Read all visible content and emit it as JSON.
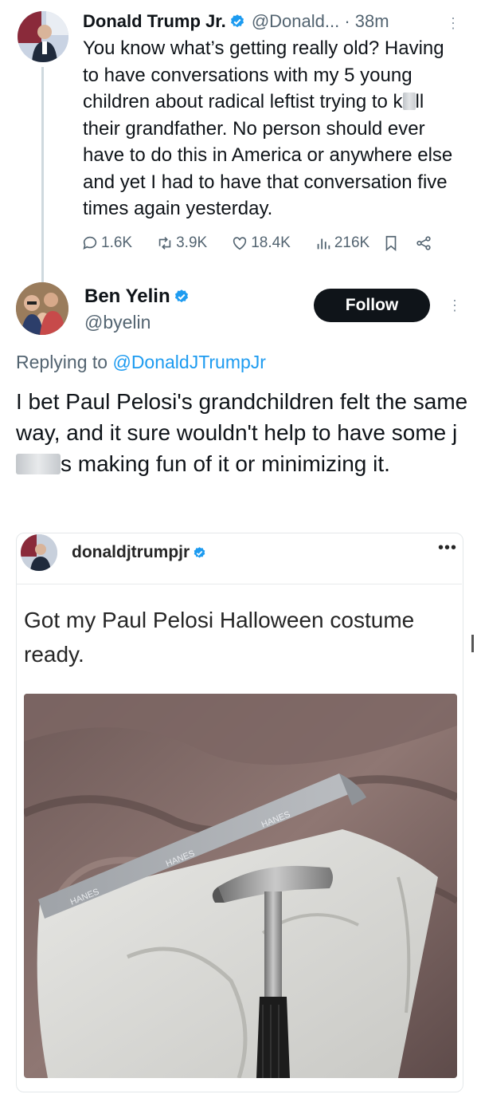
{
  "tweet1": {
    "name": "Donald Trump Jr.",
    "handle": "@Donald...",
    "time": "· 38m",
    "text_before_redact": "You know what’s getting really old? Having to have conversations with my 5 young children about radical leftist trying to k",
    "text_after_redact": "ll their grandfather. No person should ever have to do this in America or anywhere else and yet I had to have that conversation five times again yesterday.",
    "stats": {
      "replies": "1.6K",
      "reposts": "3.9K",
      "likes": "18.4K",
      "views": "216K"
    }
  },
  "tweet2": {
    "name": "Ben Yelin",
    "handle": "@byelin",
    "follow_label": "Follow",
    "replying_prefix": "Replying to",
    "replying_handle": "@DonaldJTrumpJr",
    "text_part1": "I bet Paul Pelosi's grandchildren felt the same way, and it sure wouldn't help to have some j",
    "text_part2": "s making fun of it or minimizing it."
  },
  "embed": {
    "username": "donaldjtrumpjr",
    "more": "•••",
    "caption": "Got my Paul Pelosi Halloween costume ready.",
    "waistband_text": "HANES"
  },
  "colors": {
    "accent": "#1d9bf0",
    "text": "#0f1419",
    "muted": "#536471",
    "follow_bg": "#0f1419"
  },
  "icons": [
    "verified-badge-icon",
    "reply-icon",
    "repost-icon",
    "like-icon",
    "views-icon",
    "bookmark-icon",
    "share-icon",
    "more-icon"
  ]
}
